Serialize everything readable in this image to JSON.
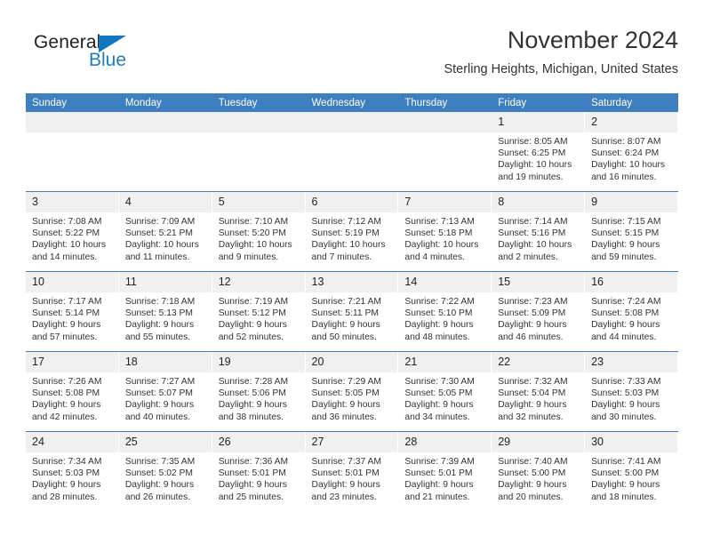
{
  "brand": {
    "name_top": "General",
    "name_bottom": "Blue",
    "triangle_icon": "blue-triangle-logo-mark",
    "accent_color": "#1476bc"
  },
  "header": {
    "title": "November 2024",
    "subtitle": "Sterling Heights, Michigan, United States"
  },
  "theme": {
    "header_row_bg": "#3d7fbf",
    "daynum_bg": "#f0f0f0",
    "row_divider": "#3d7fbf",
    "text": "#333333"
  },
  "weekday_headers": [
    "Sunday",
    "Monday",
    "Tuesday",
    "Wednesday",
    "Thursday",
    "Friday",
    "Saturday"
  ],
  "labels": {
    "sunrise_prefix": "Sunrise:",
    "sunset_prefix": "Sunset:",
    "daylight_prefix": "Daylight:"
  },
  "weeks": [
    [
      {
        "empty": true
      },
      {
        "empty": true
      },
      {
        "empty": true
      },
      {
        "empty": true
      },
      {
        "empty": true
      },
      {
        "day": "1",
        "sunrise": "Sunrise: 8:05 AM",
        "sunset": "Sunset: 6:25 PM",
        "daylight": "Daylight: 10 hours and 19 minutes."
      },
      {
        "day": "2",
        "sunrise": "Sunrise: 8:07 AM",
        "sunset": "Sunset: 6:24 PM",
        "daylight": "Daylight: 10 hours and 16 minutes."
      }
    ],
    [
      {
        "day": "3",
        "sunrise": "Sunrise: 7:08 AM",
        "sunset": "Sunset: 5:22 PM",
        "daylight": "Daylight: 10 hours and 14 minutes."
      },
      {
        "day": "4",
        "sunrise": "Sunrise: 7:09 AM",
        "sunset": "Sunset: 5:21 PM",
        "daylight": "Daylight: 10 hours and 11 minutes."
      },
      {
        "day": "5",
        "sunrise": "Sunrise: 7:10 AM",
        "sunset": "Sunset: 5:20 PM",
        "daylight": "Daylight: 10 hours and 9 minutes."
      },
      {
        "day": "6",
        "sunrise": "Sunrise: 7:12 AM",
        "sunset": "Sunset: 5:19 PM",
        "daylight": "Daylight: 10 hours and 7 minutes."
      },
      {
        "day": "7",
        "sunrise": "Sunrise: 7:13 AM",
        "sunset": "Sunset: 5:18 PM",
        "daylight": "Daylight: 10 hours and 4 minutes."
      },
      {
        "day": "8",
        "sunrise": "Sunrise: 7:14 AM",
        "sunset": "Sunset: 5:16 PM",
        "daylight": "Daylight: 10 hours and 2 minutes."
      },
      {
        "day": "9",
        "sunrise": "Sunrise: 7:15 AM",
        "sunset": "Sunset: 5:15 PM",
        "daylight": "Daylight: 9 hours and 59 minutes."
      }
    ],
    [
      {
        "day": "10",
        "sunrise": "Sunrise: 7:17 AM",
        "sunset": "Sunset: 5:14 PM",
        "daylight": "Daylight: 9 hours and 57 minutes."
      },
      {
        "day": "11",
        "sunrise": "Sunrise: 7:18 AM",
        "sunset": "Sunset: 5:13 PM",
        "daylight": "Daylight: 9 hours and 55 minutes."
      },
      {
        "day": "12",
        "sunrise": "Sunrise: 7:19 AM",
        "sunset": "Sunset: 5:12 PM",
        "daylight": "Daylight: 9 hours and 52 minutes."
      },
      {
        "day": "13",
        "sunrise": "Sunrise: 7:21 AM",
        "sunset": "Sunset: 5:11 PM",
        "daylight": "Daylight: 9 hours and 50 minutes."
      },
      {
        "day": "14",
        "sunrise": "Sunrise: 7:22 AM",
        "sunset": "Sunset: 5:10 PM",
        "daylight": "Daylight: 9 hours and 48 minutes."
      },
      {
        "day": "15",
        "sunrise": "Sunrise: 7:23 AM",
        "sunset": "Sunset: 5:09 PM",
        "daylight": "Daylight: 9 hours and 46 minutes."
      },
      {
        "day": "16",
        "sunrise": "Sunrise: 7:24 AM",
        "sunset": "Sunset: 5:08 PM",
        "daylight": "Daylight: 9 hours and 44 minutes."
      }
    ],
    [
      {
        "day": "17",
        "sunrise": "Sunrise: 7:26 AM",
        "sunset": "Sunset: 5:08 PM",
        "daylight": "Daylight: 9 hours and 42 minutes."
      },
      {
        "day": "18",
        "sunrise": "Sunrise: 7:27 AM",
        "sunset": "Sunset: 5:07 PM",
        "daylight": "Daylight: 9 hours and 40 minutes."
      },
      {
        "day": "19",
        "sunrise": "Sunrise: 7:28 AM",
        "sunset": "Sunset: 5:06 PM",
        "daylight": "Daylight: 9 hours and 38 minutes."
      },
      {
        "day": "20",
        "sunrise": "Sunrise: 7:29 AM",
        "sunset": "Sunset: 5:05 PM",
        "daylight": "Daylight: 9 hours and 36 minutes."
      },
      {
        "day": "21",
        "sunrise": "Sunrise: 7:30 AM",
        "sunset": "Sunset: 5:05 PM",
        "daylight": "Daylight: 9 hours and 34 minutes."
      },
      {
        "day": "22",
        "sunrise": "Sunrise: 7:32 AM",
        "sunset": "Sunset: 5:04 PM",
        "daylight": "Daylight: 9 hours and 32 minutes."
      },
      {
        "day": "23",
        "sunrise": "Sunrise: 7:33 AM",
        "sunset": "Sunset: 5:03 PM",
        "daylight": "Daylight: 9 hours and 30 minutes."
      }
    ],
    [
      {
        "day": "24",
        "sunrise": "Sunrise: 7:34 AM",
        "sunset": "Sunset: 5:03 PM",
        "daylight": "Daylight: 9 hours and 28 minutes."
      },
      {
        "day": "25",
        "sunrise": "Sunrise: 7:35 AM",
        "sunset": "Sunset: 5:02 PM",
        "daylight": "Daylight: 9 hours and 26 minutes."
      },
      {
        "day": "26",
        "sunrise": "Sunrise: 7:36 AM",
        "sunset": "Sunset: 5:01 PM",
        "daylight": "Daylight: 9 hours and 25 minutes."
      },
      {
        "day": "27",
        "sunrise": "Sunrise: 7:37 AM",
        "sunset": "Sunset: 5:01 PM",
        "daylight": "Daylight: 9 hours and 23 minutes."
      },
      {
        "day": "28",
        "sunrise": "Sunrise: 7:39 AM",
        "sunset": "Sunset: 5:01 PM",
        "daylight": "Daylight: 9 hours and 21 minutes."
      },
      {
        "day": "29",
        "sunrise": "Sunrise: 7:40 AM",
        "sunset": "Sunset: 5:00 PM",
        "daylight": "Daylight: 9 hours and 20 minutes."
      },
      {
        "day": "30",
        "sunrise": "Sunrise: 7:41 AM",
        "sunset": "Sunset: 5:00 PM",
        "daylight": "Daylight: 9 hours and 18 minutes."
      }
    ]
  ]
}
